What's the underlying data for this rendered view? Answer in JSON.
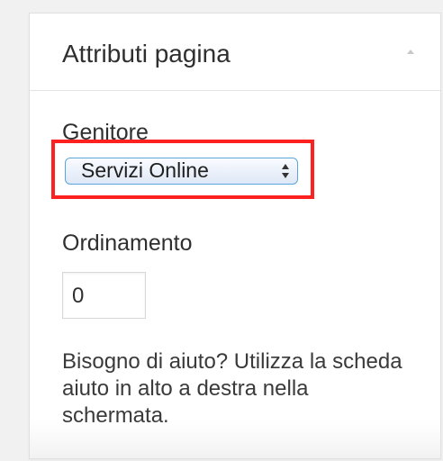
{
  "panel": {
    "title": "Attributi pagina",
    "toggle_icon": "collapse-arrow-icon"
  },
  "parent": {
    "label": "Genitore",
    "selected": "Servizi Online",
    "select_icon": "select-arrows-icon"
  },
  "ordering": {
    "label": "Ordinamento",
    "value": "0"
  },
  "help": {
    "line_1": "Bisogno di aiuto? Utilizza la scheda",
    "line_2": "aiuto in alto a destra nella",
    "line_3": "schermata."
  },
  "colors": {
    "highlight": "#ff2020",
    "select_border": "#5aa5dc"
  }
}
